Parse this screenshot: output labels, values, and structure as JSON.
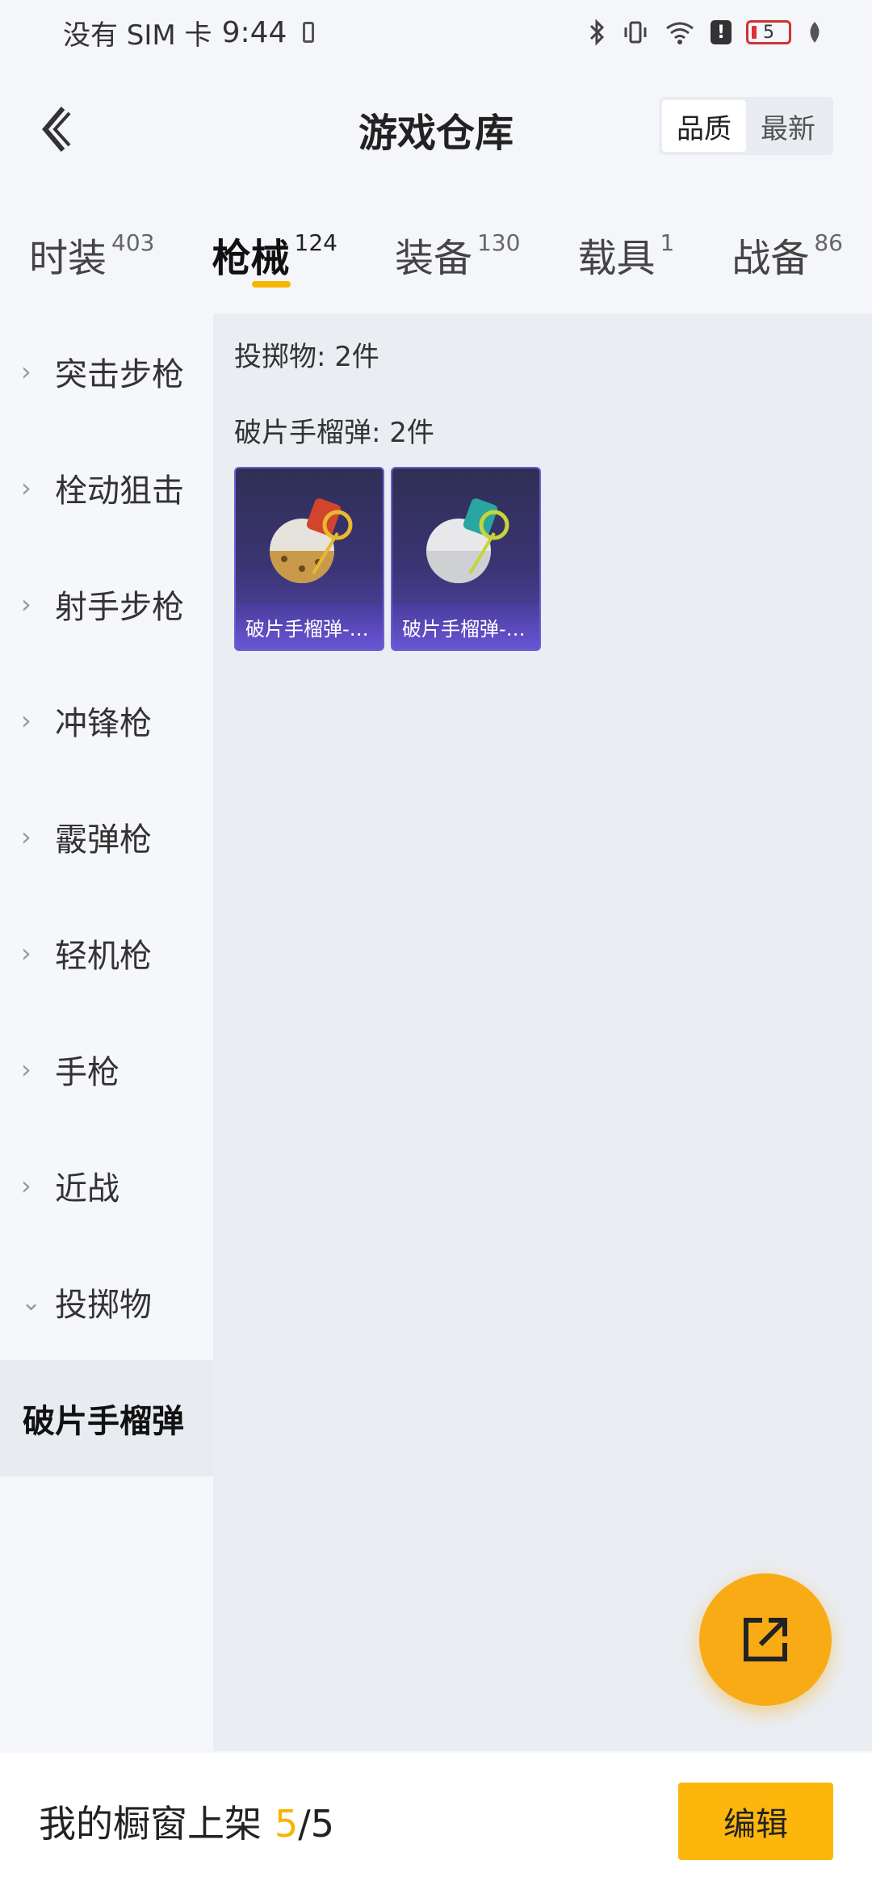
{
  "status_bar": {
    "carrier": "没有 SIM 卡",
    "time": "9:44",
    "battery_level": "5",
    "icons": [
      "phone-icon",
      "bluetooth-icon",
      "vibrate-icon",
      "wifi-icon",
      "alert-icon",
      "battery-icon",
      "leaf-icon"
    ]
  },
  "header": {
    "title": "游戏仓库",
    "sort_options": [
      "品质",
      "最新"
    ],
    "active_sort": "品质"
  },
  "tabs": [
    {
      "label": "时装",
      "count": "403"
    },
    {
      "label": "枪械",
      "count": "124"
    },
    {
      "label": "装备",
      "count": "130"
    },
    {
      "label": "载具",
      "count": "1"
    },
    {
      "label": "战备",
      "count": "86"
    }
  ],
  "active_tab": "枪械",
  "sidebar": {
    "items": [
      {
        "label": "突击步枪",
        "expanded": false
      },
      {
        "label": "栓动狙击",
        "expanded": false
      },
      {
        "label": "射手步枪",
        "expanded": false
      },
      {
        "label": "冲锋枪",
        "expanded": false
      },
      {
        "label": "霰弹枪",
        "expanded": false
      },
      {
        "label": "轻机枪",
        "expanded": false
      },
      {
        "label": "手枪",
        "expanded": false
      },
      {
        "label": "近战",
        "expanded": false
      },
      {
        "label": "投掷物",
        "expanded": true
      }
    ],
    "sub_item": "破片手榴弹"
  },
  "content": {
    "group_title": "投掷物: 2件",
    "sub_group_title": "破片手榴弹: 2件",
    "cards": [
      {
        "label": "破片手榴弹-…",
        "accent": "#e0752a"
      },
      {
        "label": "破片手榴弹-…",
        "accent": "#2aa6a0"
      }
    ]
  },
  "bottom_bar": {
    "label": "我的橱窗上架",
    "current": "5",
    "total": "/5",
    "edit_label": "编辑"
  },
  "colors": {
    "accent": "#f7b500",
    "card_bg": "#3b3474"
  }
}
